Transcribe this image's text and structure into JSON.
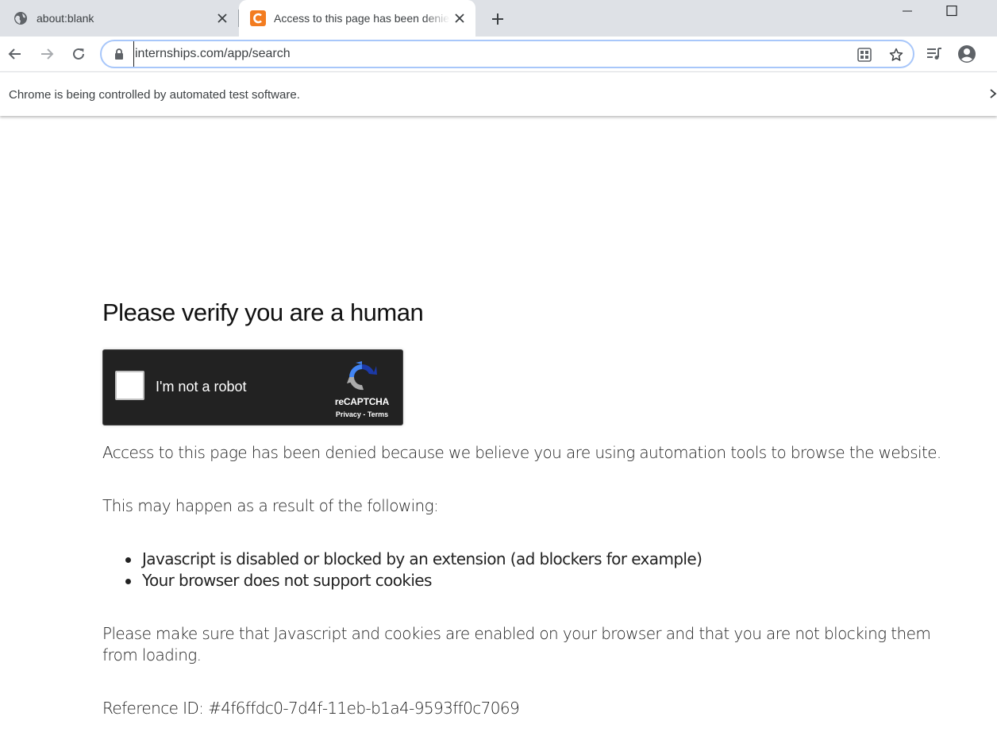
{
  "browser": {
    "tabs": [
      {
        "title": "about:blank",
        "favicon": "globe-icon",
        "active": false
      },
      {
        "title": "Access to this page has been denied",
        "favicon": "site-c-icon",
        "active": true
      }
    ],
    "url": "internships.com/app/search",
    "infobar_message": "Chrome is being controlled by automated test software.",
    "colors": {
      "tabstrip": "#dee1e6",
      "favicon_accent": "#f37c20",
      "omnibox_focus": "#a8c7fa"
    }
  },
  "page": {
    "heading": "Please verify you are a human",
    "captcha": {
      "label": "I'm not a robot",
      "brand": "reCAPTCHA",
      "links": "Privacy - Terms",
      "checked": false
    },
    "paragraph1": "Access to this page has been denied because we believe you are using automation tools to browse the website.",
    "paragraph2": "This may happen as a result of the following:",
    "reasons": [
      "Javascript is disabled or blocked by an extension (ad blockers for example)",
      "Your browser does not support cookies"
    ],
    "paragraph3": "Please make sure that Javascript and cookies are enabled on your browser and that you are not blocking them from loading.",
    "reference": "Reference ID: #4f6ffdc0-7d4f-11eb-b1a4-9593ff0c7069"
  }
}
